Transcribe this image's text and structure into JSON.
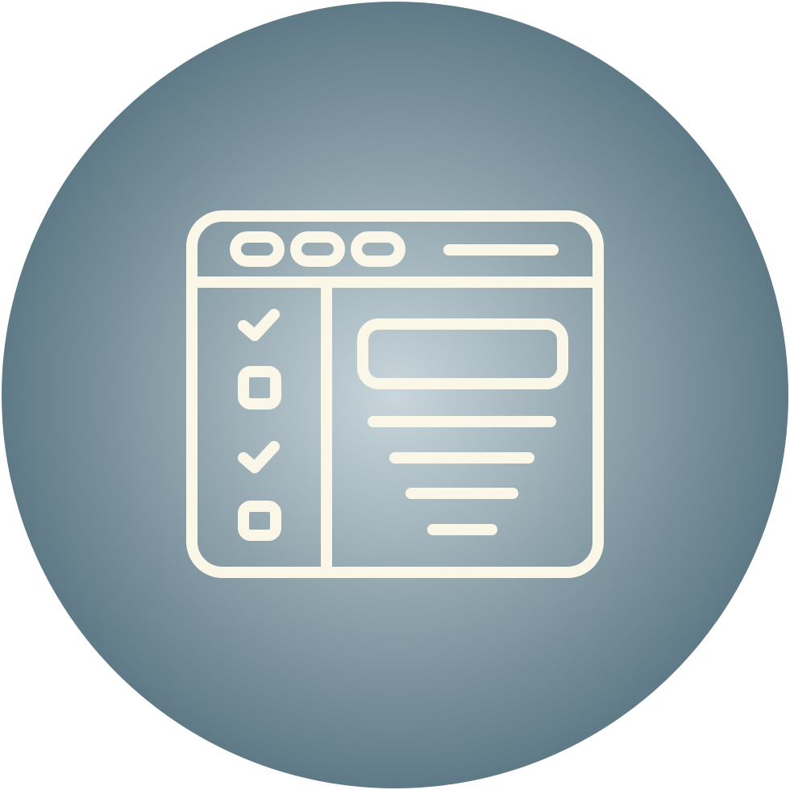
{
  "icon": {
    "name": "browser-checklist-icon",
    "background_gradient": {
      "center_color": "#c9d6dc",
      "mid_color": "#8ea2ab",
      "edge_color": "#5f7a87"
    },
    "stroke_color": "#fbf7e8",
    "window_controls": [
      "control-dot",
      "control-dot",
      "control-dot"
    ],
    "checklist_items": [
      {
        "state": "checked",
        "icon": "checkmark-icon"
      },
      {
        "state": "unchecked",
        "icon": "checkbox-icon"
      },
      {
        "state": "checked",
        "icon": "checkmark-icon"
      },
      {
        "state": "unchecked",
        "icon": "checkbox-icon"
      }
    ],
    "content_lines": 4
  }
}
